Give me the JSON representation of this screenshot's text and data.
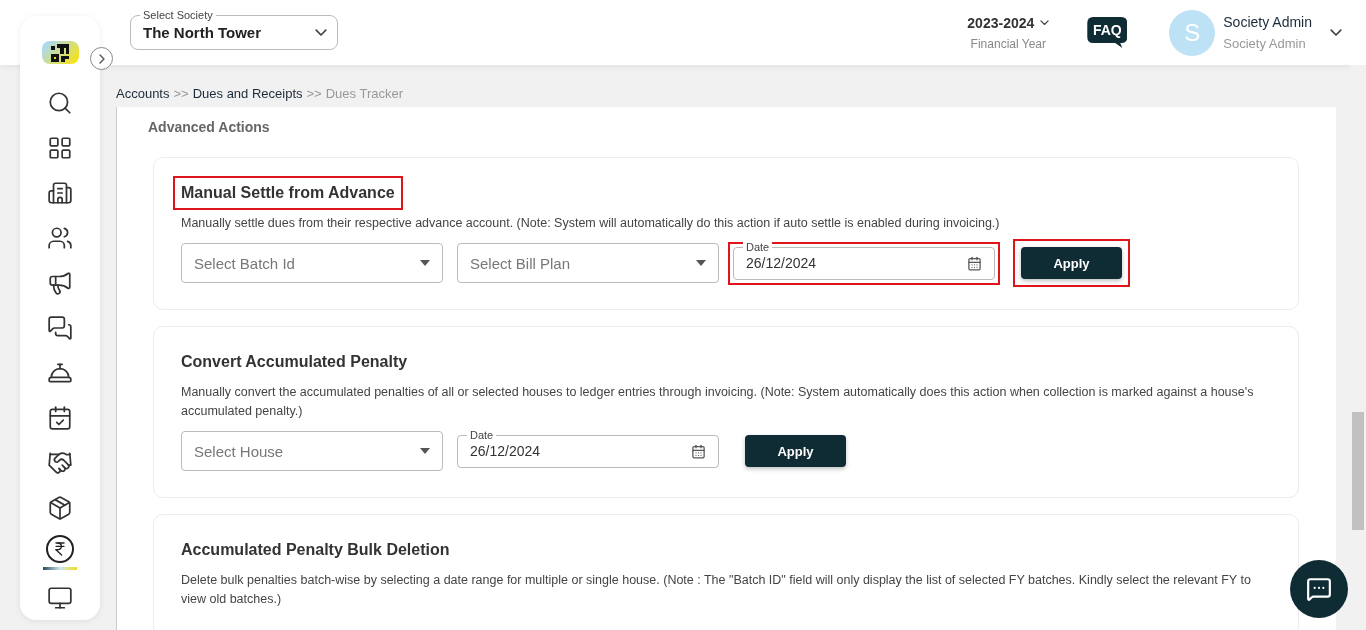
{
  "sidebar": {
    "items": [
      {
        "kind": "search",
        "selected": false
      },
      {
        "kind": "dashboard",
        "selected": false
      },
      {
        "kind": "building",
        "selected": false
      },
      {
        "kind": "people",
        "selected": false
      },
      {
        "kind": "megaphone",
        "selected": false
      },
      {
        "kind": "chat",
        "selected": false
      },
      {
        "kind": "desk",
        "selected": false
      },
      {
        "kind": "calendar",
        "selected": false
      },
      {
        "kind": "handshake",
        "selected": false
      },
      {
        "kind": "box",
        "selected": false
      },
      {
        "kind": "rupee",
        "selected": true
      },
      {
        "kind": "partial",
        "selected": false
      }
    ]
  },
  "header": {
    "society_select": {
      "label": "Select Society",
      "value": "The North Tower"
    },
    "financial_year": {
      "value": "2023-2024",
      "caption": "Financial Year"
    },
    "faq": "FAQ",
    "user": {
      "avatar": "S",
      "name": "Society Admin",
      "role": "Society Admin"
    }
  },
  "breadcrumb": [
    {
      "kind": "link",
      "label": "Accounts",
      "current": false
    },
    {
      "kind": "separator",
      "label": ">>"
    },
    {
      "kind": "link",
      "label": "Dues and Receipts",
      "current": false
    },
    {
      "kind": "separator",
      "label": ">>"
    },
    {
      "kind": "link",
      "label": "Dues Tracker",
      "current": true
    }
  ],
  "section_title": "Advanced Actions",
  "cards": [
    {
      "title": "Manual Settle from Advance",
      "highlighted": true,
      "description": "Manually settle dues from their respective advance account. (Note: System will automatically do this action if auto settle is enabled during invoicing.)",
      "controls": [
        {
          "kind": "select",
          "placeholder": "Select Batch Id",
          "highlighted": false
        },
        {
          "kind": "select",
          "placeholder": "Select Bill Plan",
          "highlighted": false
        },
        {
          "kind": "date",
          "label": "Date",
          "value": "26/12/2024",
          "highlighted": true
        },
        {
          "kind": "button",
          "label": "Apply",
          "highlighted": true
        }
      ]
    },
    {
      "title": "Convert Accumulated Penalty",
      "highlighted": false,
      "description": "Manually convert the accumulated penalties of all or selected houses to ledger entries through invoicing. (Note: System automatically does this action when collection is marked against a house's accumulated penalty.)",
      "controls": [
        {
          "kind": "select",
          "placeholder": "Select House",
          "highlighted": false
        },
        {
          "kind": "date",
          "label": "Date",
          "value": "26/12/2024",
          "highlighted": false
        },
        {
          "kind": "button",
          "label": "Apply",
          "highlighted": false
        }
      ]
    },
    {
      "title": "Accumulated Penalty Bulk Deletion",
      "highlighted": false,
      "description": "Delete bulk penalties batch-wise by selecting a date range for multiple or single house. (Note : The \"Batch ID\" field will only display the list of selected FY batches. Kindly select the relevant FY to view old batches.)"
    }
  ]
}
